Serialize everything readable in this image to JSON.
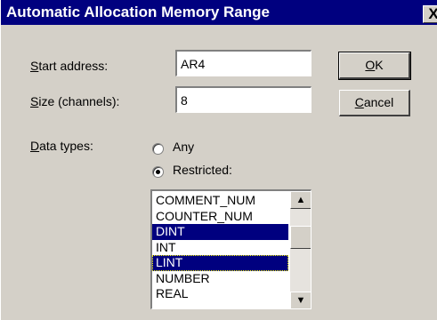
{
  "window": {
    "title": "Automatic Allocation Memory Range",
    "close_glyph": "X"
  },
  "form": {
    "start_address_label": "Start address:",
    "start_address_value": "AR4",
    "size_label": "Size (channels):",
    "size_value": "8",
    "data_types_label": "Data types:",
    "radio_any_label": "Any",
    "radio_restricted_label": "Restricted:",
    "selected_radio": "Restricted:"
  },
  "buttons": {
    "ok": "OK",
    "cancel": "Cancel"
  },
  "list": {
    "items": [
      "COMMENT_NUM",
      "COUNTER_NUM",
      "DINT",
      "INT",
      "LINT",
      "NUMBER",
      "REAL"
    ],
    "selected": [
      "DINT",
      "LINT"
    ],
    "focused": "LINT",
    "scroll_up_glyph": "▲",
    "scroll_down_glyph": "▼"
  }
}
